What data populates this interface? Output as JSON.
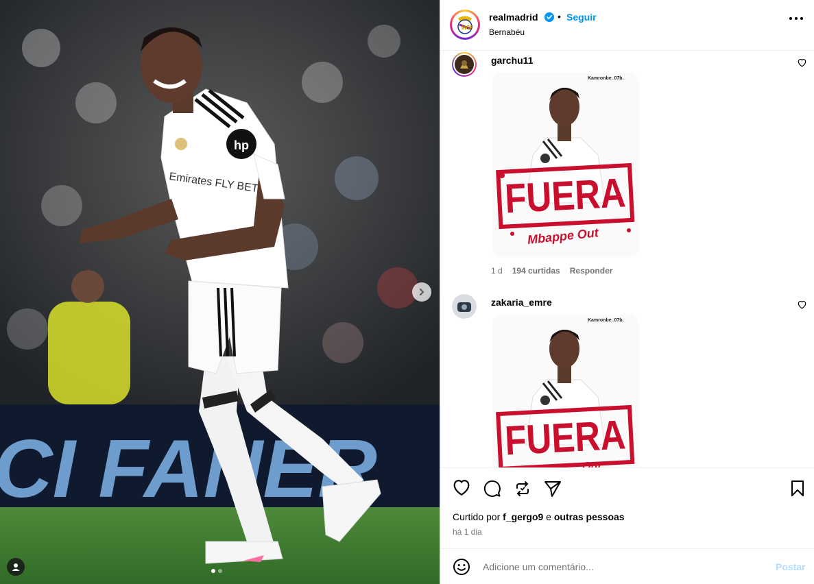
{
  "post": {
    "username": "realmadrid",
    "verified": true,
    "separator": "•",
    "follow_label": "Seguir",
    "location": "Bernabéu",
    "more_icon": "more-horizontal-icon"
  },
  "media": {
    "background_text": "CI FANER",
    "shirt_sponsor": "hp",
    "shirt_text": "Emirates FLY BETTER",
    "carousel_total": 2,
    "carousel_active": 1
  },
  "comments": [
    {
      "username": "garchu11",
      "sticker": {
        "watermark": "Kamronbe_07b.",
        "headline": "FUERA",
        "subline": "Mbappe Out"
      },
      "age": "1 d",
      "likes": "194 curtidas",
      "reply_label": "Responder"
    },
    {
      "username": "zakaria_emre",
      "sticker": {
        "watermark": "Kamronbe_07b.",
        "headline": "FUERA",
        "subline": "Out"
      }
    }
  ],
  "likes": {
    "prefix": "Curtido por",
    "user": "f_gergo9",
    "middle": "e",
    "suffix": "outras pessoas"
  },
  "timestamp": "há 1 dia",
  "composer": {
    "placeholder": "Adicione um comentário...",
    "post_label": "Postar"
  },
  "colors": {
    "accent": "#0095f6",
    "post_disabled": "#b3dbff",
    "verified": "#0095f6",
    "muted": "#737373",
    "sticker_red": "#c8102e"
  }
}
